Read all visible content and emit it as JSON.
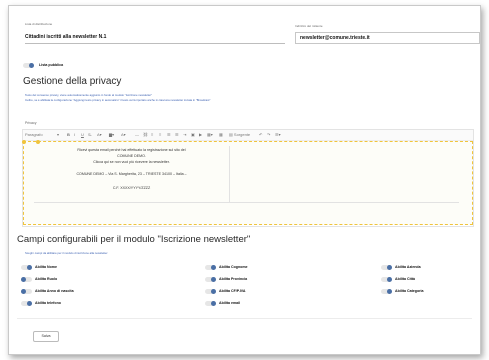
{
  "form": {
    "list_name_label": "Lista di distribuzione",
    "list_name_value": "Cittadini iscritti alla newsletter N.1",
    "sender_label": "Indirizzo del mittente",
    "sender_value": "newsletter@comune.trieste.it"
  },
  "public_list": {
    "label": "Lista pubblica",
    "enabled": true
  },
  "privacy": {
    "title": "Gestione della privacy",
    "desc_line1": "Testo del consenso privacy, viene automaticamente aggiunto in fondo al modulo \"Iscrizione newsletter\"",
    "desc_line2": "Inoltre, se è abilitata la configurazione \"Aggiungi testo privacy in automatico\" il testo verrà riportato anche in ciascuna newsletter inviata in \"Broadcast\"",
    "field_label": "Privacy"
  },
  "toolbar": {
    "paragraph": "Paragrafo",
    "source": "Sorgente"
  },
  "editor_content": {
    "line1": "Ricevi questa email perché hai effettuato la registrazione sul sito del",
    "line2": "COMUNE DEMO.",
    "line3": "Clicca qui se non vuoi più ricevere la newsletter.",
    "line4": "COMUNE DEMO – Via S. Margherita, 23 – TRIESTE 34100 – Italia –",
    "line5": "C.F. XXXX/YYYY/ZZZZ"
  },
  "fields_section": {
    "title": "Campi configurabili per il modulo \"Iscrizione newsletter\"",
    "desc": "Scegli i campi da abilitare per il modulo di iscrizione alla newsletter"
  },
  "fields": [
    {
      "label": "Abilita Nome",
      "enabled": true
    },
    {
      "label": "Abilita Cognome",
      "enabled": true
    },
    {
      "label": "Abilita Azienda",
      "enabled": true
    },
    {
      "label": "Abilita Ruolo",
      "enabled": false
    },
    {
      "label": "Abilita Provincia",
      "enabled": true
    },
    {
      "label": "Abilita Città",
      "enabled": true
    },
    {
      "label": "Abilita Anno di nascita",
      "enabled": false
    },
    {
      "label": "Abilita CF/P.IVA",
      "enabled": true
    },
    {
      "label": "Abilita Categoria",
      "enabled": true
    },
    {
      "label": "Abilita telefono",
      "enabled": true
    },
    {
      "label": "Abilita email",
      "enabled": true
    }
  ],
  "actions": {
    "save": "Salva"
  }
}
